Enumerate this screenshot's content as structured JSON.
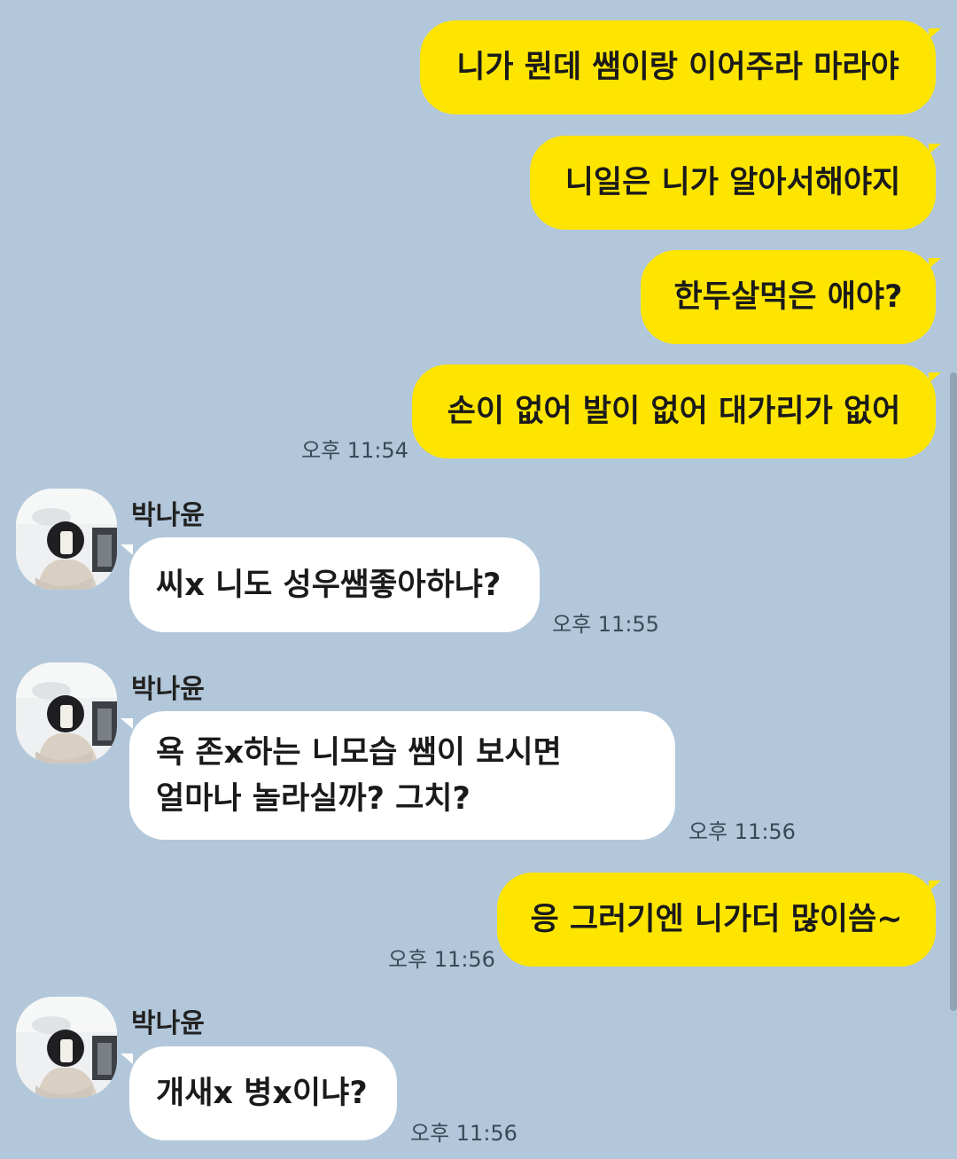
{
  "contact_name": "박나윤",
  "messages": [
    {
      "from": "me",
      "text": "니가 뭔데 쌤이랑 이어주라 마라야"
    },
    {
      "from": "me",
      "text": "니일은 니가 알아서해야지"
    },
    {
      "from": "me",
      "text": "한두살먹은 애야?"
    },
    {
      "from": "me",
      "text": "손이 없어 발이 없어 대가리가 없어",
      "time": "오후 11:54"
    },
    {
      "from": "them",
      "sender": "박나윤",
      "text": "씨x 니도 성우쌤좋아하냐?",
      "time": "오후 11:55"
    },
    {
      "from": "them",
      "sender": "박나윤",
      "lines": [
        "욕 존x하는 니모습 쌤이 보시면",
        "얼마나 놀라실까? 그치?"
      ],
      "time": "오후 11:56"
    },
    {
      "from": "me",
      "text": "응 그러기엔 니가더 많이씀~",
      "time": "오후 11:56"
    },
    {
      "from": "them",
      "sender": "박나윤",
      "text": "개새x 병x이냐?",
      "time": "오후 11:56"
    }
  ],
  "colors": {
    "background": "#b2c7da",
    "my_bubble": "#fee500",
    "their_bubble": "#ffffff"
  }
}
